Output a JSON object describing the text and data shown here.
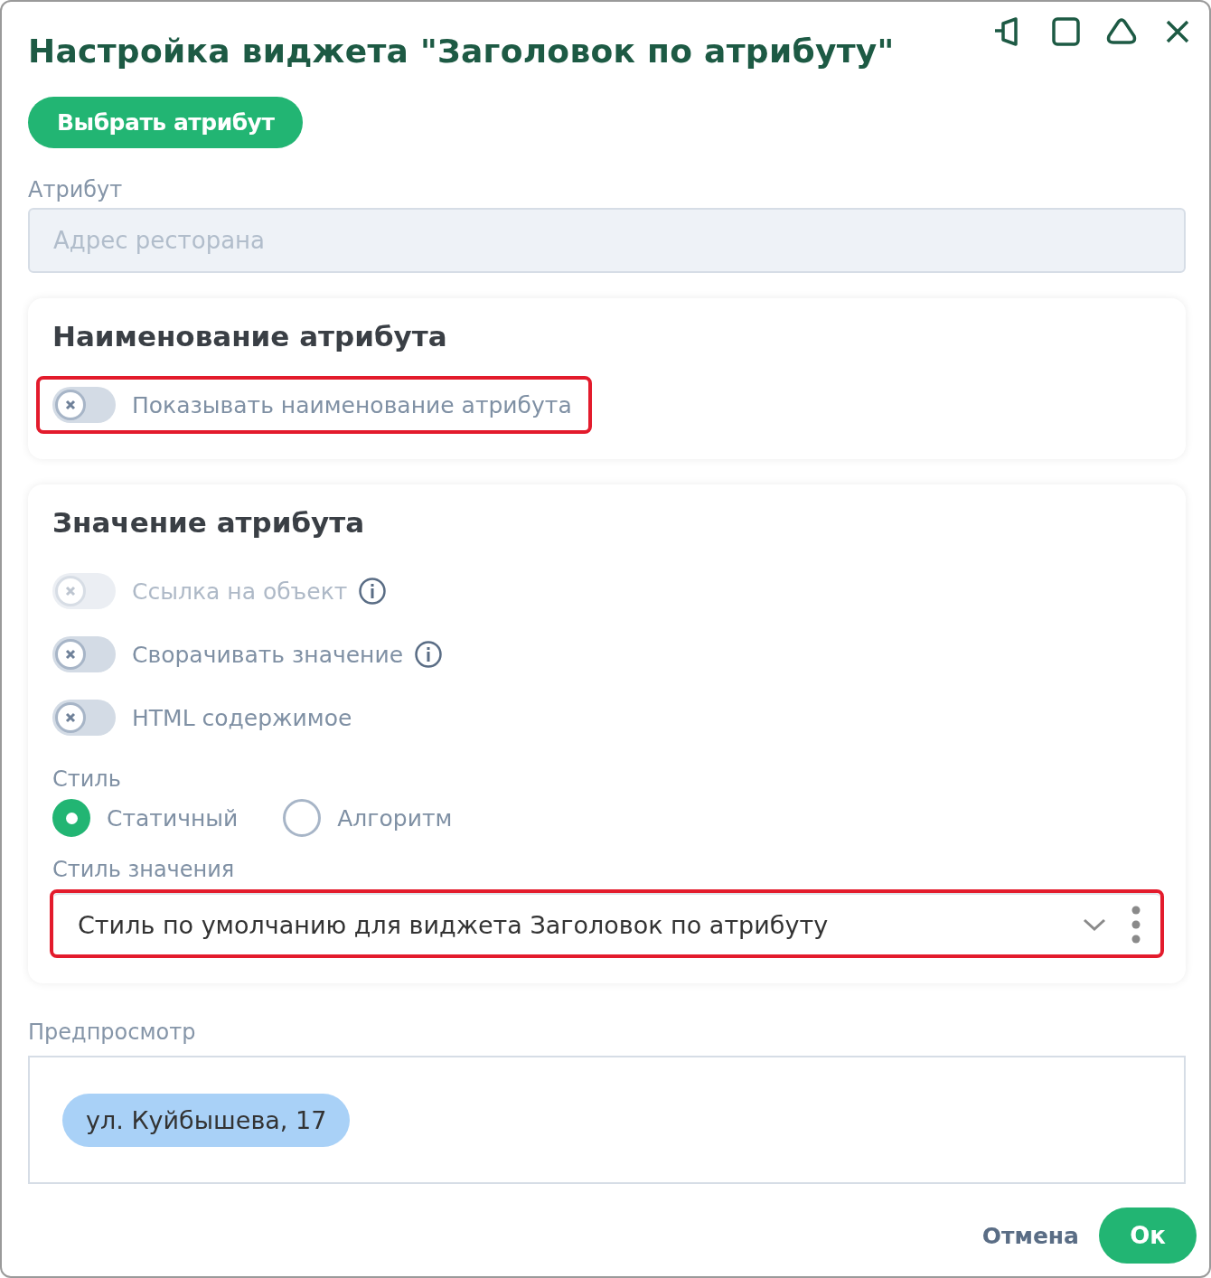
{
  "window": {
    "title": "Настройка виджета \"Заголовок по атрибуту\""
  },
  "choose_button": "Выбрать атрибут",
  "attribute": {
    "label": "Атрибут",
    "placeholder": "Адрес ресторана"
  },
  "name_section": {
    "title": "Наименование атрибута",
    "switches": [
      {
        "label": "Показывать наименование атрибута",
        "on": false,
        "disabled": false,
        "info": false,
        "highlighted": true
      }
    ]
  },
  "value_section": {
    "title": "Значение атрибута",
    "switches": [
      {
        "label": "Ссылка на объект",
        "on": false,
        "disabled": true,
        "info": true,
        "highlighted": false
      },
      {
        "label": "Сворачивать значение",
        "on": false,
        "disabled": false,
        "info": true,
        "highlighted": false
      },
      {
        "label": "HTML содержимое",
        "on": false,
        "disabled": false,
        "info": false,
        "highlighted": false
      }
    ],
    "style_label": "Стиль",
    "style_options": [
      {
        "label": "Статичный",
        "selected": true
      },
      {
        "label": "Алгоритм",
        "selected": false
      }
    ],
    "value_style": {
      "label": "Стиль значения",
      "value": "Стиль по умолчанию для виджета Заголовок по атрибуту",
      "highlighted": true
    }
  },
  "preview": {
    "label": "Предпросмотр",
    "chip": "ул. Куйбышева, 17"
  },
  "footer": {
    "cancel": "Отмена",
    "ok": "Ок"
  }
}
